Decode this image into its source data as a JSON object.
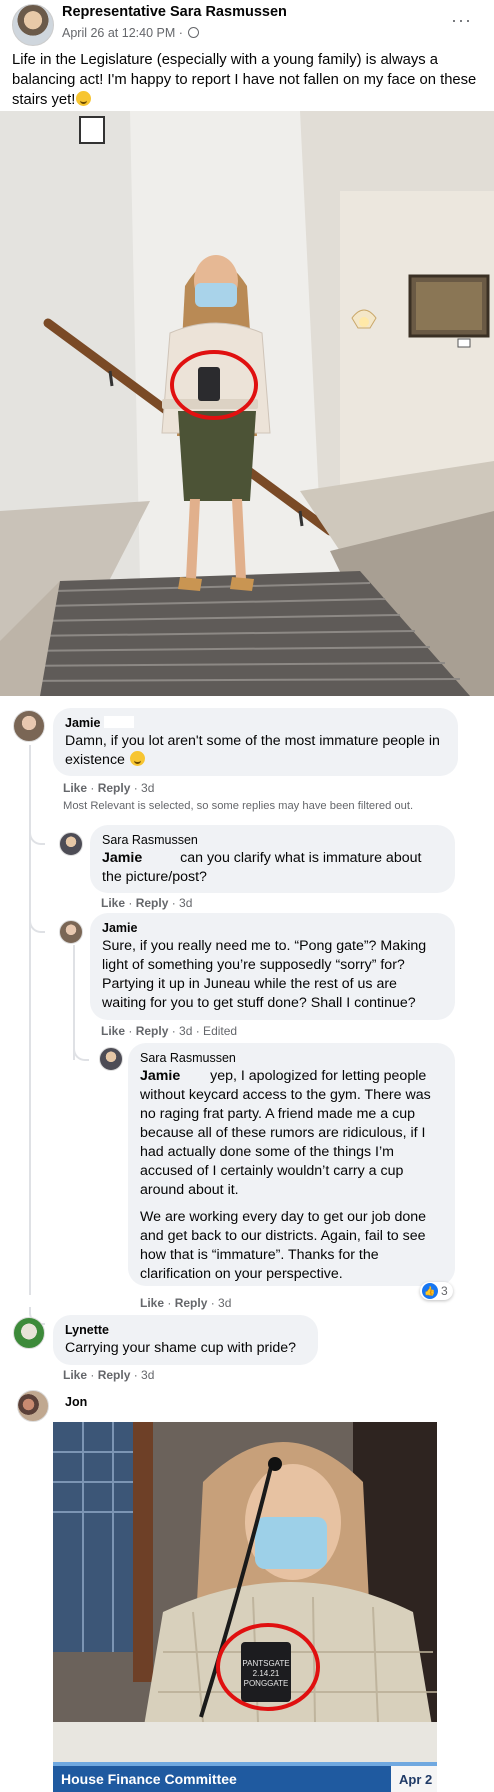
{
  "post": {
    "author": "Representative Sara Rasmussen",
    "meta": "April 26 at 12:40 PM ·",
    "text": "Life in the Legislature (especially with a young family) is always a balancing act! I'm happy to report I have not fallen on my face on these stairs yet!",
    "more": "···"
  },
  "comments": [
    {
      "name": "Jamie",
      "text": "Damn, if you lot aren't some of the most immature people in existence",
      "like": "Like",
      "reply": "Reply",
      "time": "3d"
    },
    {
      "name": "Sara Rasmussen",
      "mention": "Jamie",
      "text": "can you clarify what is immature about the picture/post?",
      "like": "Like",
      "reply": "Reply",
      "time": "3d"
    },
    {
      "name": "Jamie",
      "text": "Sure, if you really need me to. “Pong gate”? Making light of something you’re supposedly “sorry” for? Partying it up in Juneau while the rest of us are waiting for you to get stuff done? Shall I continue?",
      "like": "Like",
      "reply": "Reply",
      "time": "3d · Edited"
    },
    {
      "name": "Sara Rasmussen",
      "mention": "Jamie",
      "text": "yep, I apologized for letting people without keycard access to the gym. There was no raging frat party. A friend made me a cup because all of these rumors are ridiculous, if I had actually done some of the things I’m accused of I certainly wouldn’t carry a cup around about it.",
      "text2": "We are working every day to get our job done and get back to our districts. Again, fail to see how that is “immature”. Thanks for the clarification on your perspective.",
      "like": "Like",
      "reply": "Reply",
      "time": "3d",
      "reactions": "3"
    },
    {
      "name": "Lynette",
      "text": "Carrying your shame cup with pride?",
      "like": "Like",
      "reply": "Reply",
      "time": "3d"
    },
    {
      "name": "Jon"
    }
  ],
  "filter_note": "Most Relevant is selected, so some replies may have been filtered out.",
  "photo2": {
    "banner": "House Finance Committee",
    "date": "Apr 2",
    "cup_text_1": "PANTSGATE",
    "cup_text_2": "2.14.21",
    "cup_text_3": "PONGGATE"
  },
  "colors": {
    "link_blue": "#1877f2",
    "bubble": "#f0f2f5",
    "meta": "#65676b",
    "highlight_red": "#e01010"
  }
}
